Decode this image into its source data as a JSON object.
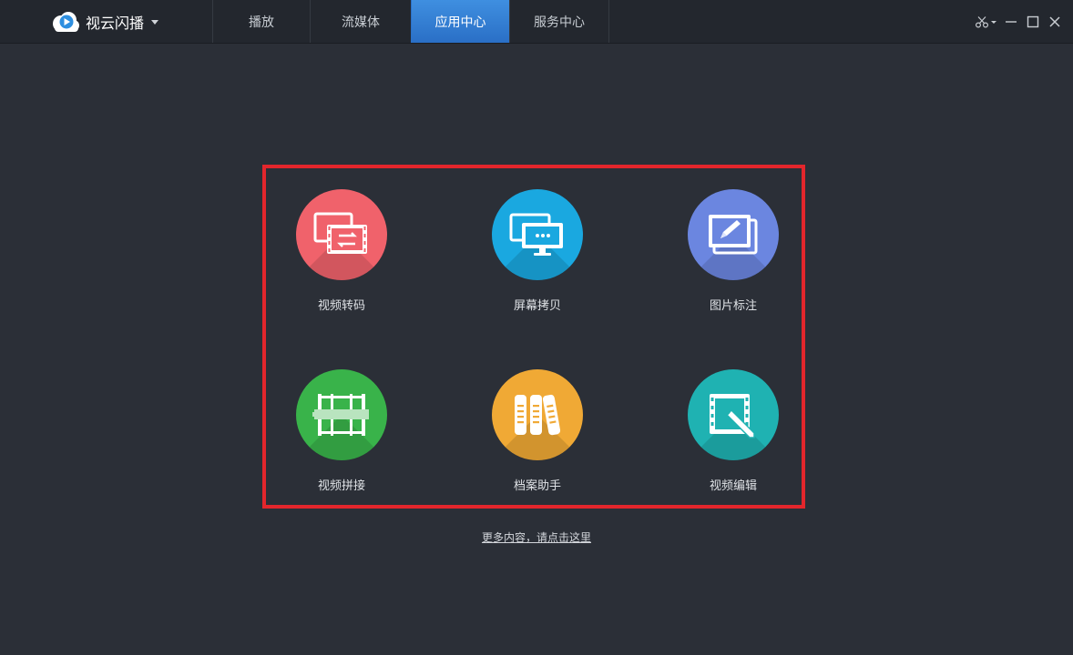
{
  "brand": {
    "name": "视云闪播",
    "logo_icon": "cloud-play-icon"
  },
  "tabs": [
    {
      "label": "播放",
      "active": false
    },
    {
      "label": "流媒体",
      "active": false
    },
    {
      "label": "应用中心",
      "active": true
    },
    {
      "label": "服务中心",
      "active": false
    }
  ],
  "window_controls": [
    "scissors-icon",
    "minimize-icon",
    "maximize-icon",
    "close-icon"
  ],
  "apps": [
    {
      "label": "视频转码",
      "icon": "video-transcode-icon",
      "color": "#f0626b"
    },
    {
      "label": "屏幕拷贝",
      "icon": "screen-copy-icon",
      "color": "#1aa8e0"
    },
    {
      "label": "图片标注",
      "icon": "image-annotate-icon",
      "color": "#6b86e0"
    },
    {
      "label": "视频拼接",
      "icon": "video-splice-icon",
      "color": "#39b34a"
    },
    {
      "label": "档案助手",
      "icon": "archive-assistant-icon",
      "color": "#f0a935"
    },
    {
      "label": "视频编辑",
      "icon": "video-edit-icon",
      "color": "#1fb2b2"
    }
  ],
  "colors": {
    "highlight_border": "#e3262c",
    "active_tab": "#3a86d9",
    "background": "#2b2f37"
  },
  "footer": {
    "more_link": "更多内容，请点击这里"
  }
}
